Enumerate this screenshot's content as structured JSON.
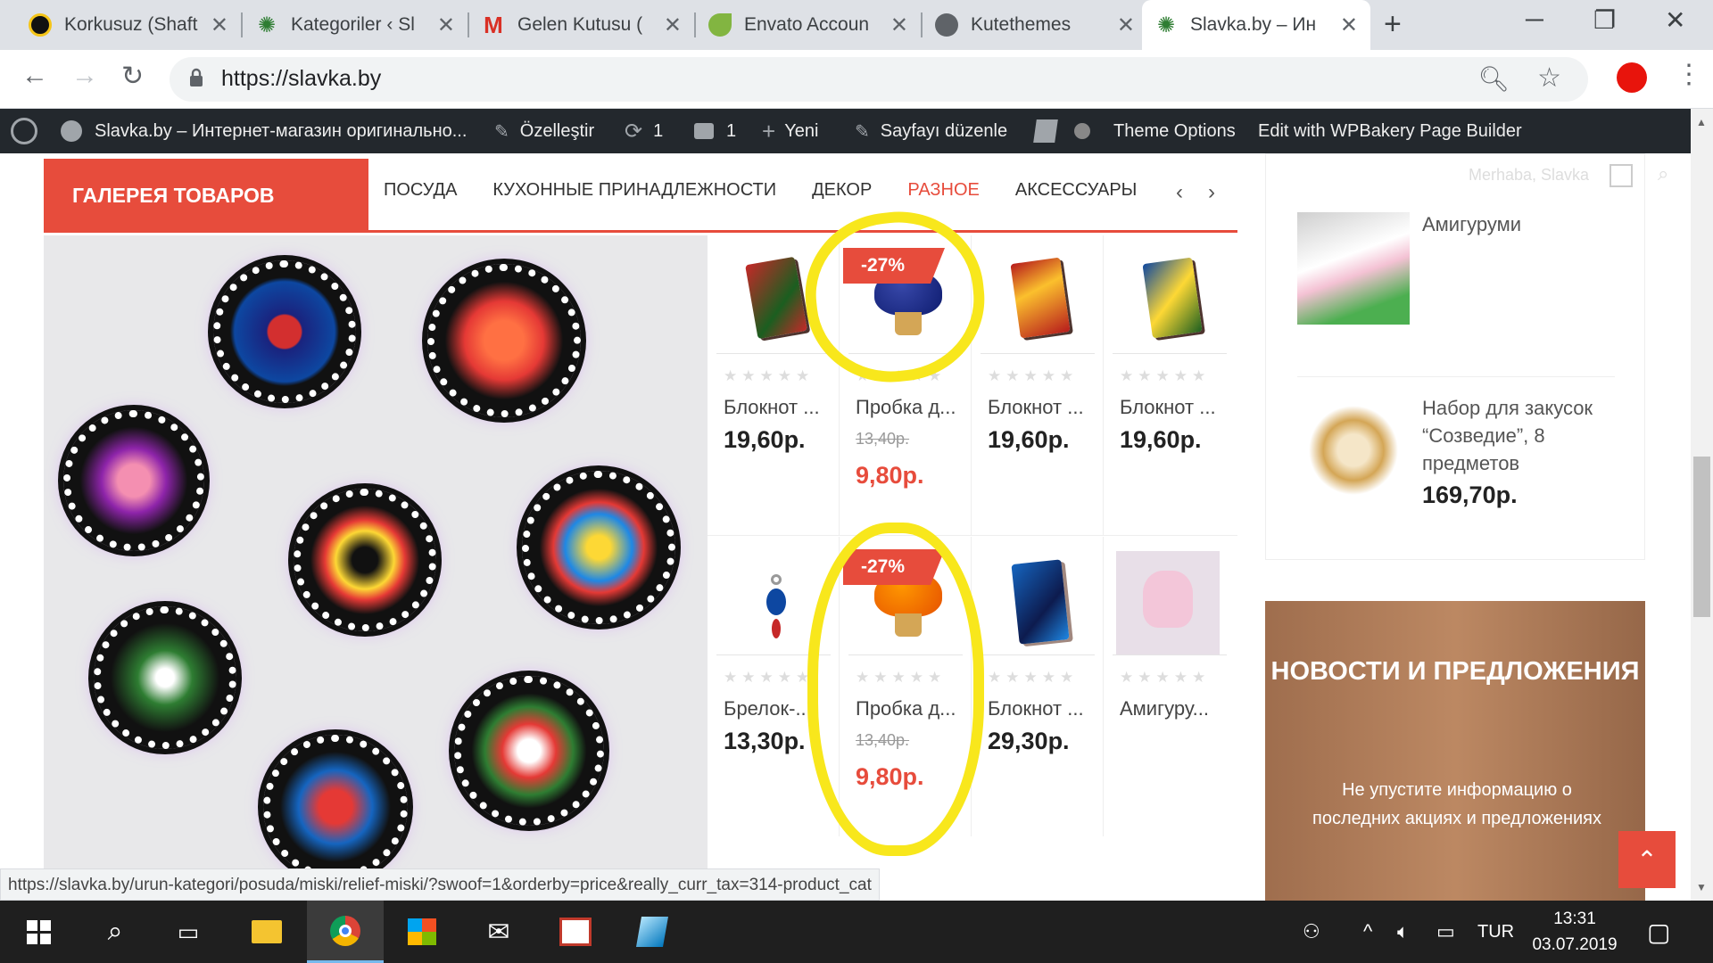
{
  "tabs": [
    {
      "title": "Korkusuz (Shaft",
      "icon": "site-icon"
    },
    {
      "title": "Kategoriler ‹ Sl",
      "icon": "site-icon"
    },
    {
      "title": "Gelen Kutusu (",
      "icon": "gmail-icon"
    },
    {
      "title": "Envato Accoun",
      "icon": "envato-icon"
    },
    {
      "title": "Kutethemes",
      "icon": "globe-icon"
    },
    {
      "title": "Slavka.by – Ин",
      "icon": "site-icon"
    }
  ],
  "address": {
    "url": "https://slavka.by"
  },
  "wpbar": {
    "site": "Slavka.by – Интернет-магазин оригинально...",
    "customize": "Özelleştir",
    "updates": "1",
    "comments": "1",
    "new": "Yeni",
    "edit": "Sayfayı düzenle",
    "theme_options": "Theme Options",
    "wpbakery": "Edit with WPBakery Page Builder"
  },
  "gallery": {
    "title": "ГАЛЕРЕЯ ТОВАРОВ",
    "categories": [
      "ПОСУДА",
      "КУХОННЫЕ ПРИНАДЛЕЖНОСТИ",
      "ДЕКОР",
      "РАЗНОЕ",
      "АКСЕССУАРЫ"
    ],
    "active_category": "РАЗНОЕ",
    "prev": "‹",
    "next": "›"
  },
  "products": [
    {
      "name": "Блокнот ...",
      "price": "19,60р.",
      "old_price": "",
      "badge": ""
    },
    {
      "name": "Пробка д...",
      "price": "9,80р.",
      "old_price": "13,40р.",
      "badge": "-27%"
    },
    {
      "name": "Блокнот ...",
      "price": "19,60р.",
      "old_price": "",
      "badge": ""
    },
    {
      "name": "Блокнот ...",
      "price": "19,60р.",
      "old_price": "",
      "badge": ""
    },
    {
      "name": "Брелок-...",
      "price": "13,30р.",
      "old_price": "",
      "badge": ""
    },
    {
      "name": "Пробка д...",
      "price": "9,80р.",
      "old_price": "13,40р.",
      "badge": "-27%"
    },
    {
      "name": "Блокнот ...",
      "price": "29,30р.",
      "old_price": "",
      "badge": ""
    },
    {
      "name": "Амигуру...",
      "price": "",
      "old_price": "",
      "badge": ""
    }
  ],
  "rating_stars": "★★★★★",
  "sidebar": {
    "greeting": "Merhaba, Slavka",
    "items": [
      {
        "title": "Амигуруми",
        "price": ""
      },
      {
        "title": "Набор для закусок “Созведие”, 8 предметов",
        "price": "169,70р."
      }
    ],
    "news_title": "НОВОСТИ И ПРЕДЛОЖЕНИЯ",
    "news_text": "Не упустите информацию о последних акциях и предложениях"
  },
  "status_url": "https://slavka.by/urun-kategori/posuda/miski/relief-miski/?swoof=1&orderby=price&really_curr_tax=314-product_cat",
  "taskbar": {
    "language": "TUR",
    "time": "13:31",
    "date": "03.07.2019"
  },
  "colors": {
    "accent": "#e74c3c",
    "highlight": "#f8e71c",
    "wpbar": "#23282d"
  }
}
